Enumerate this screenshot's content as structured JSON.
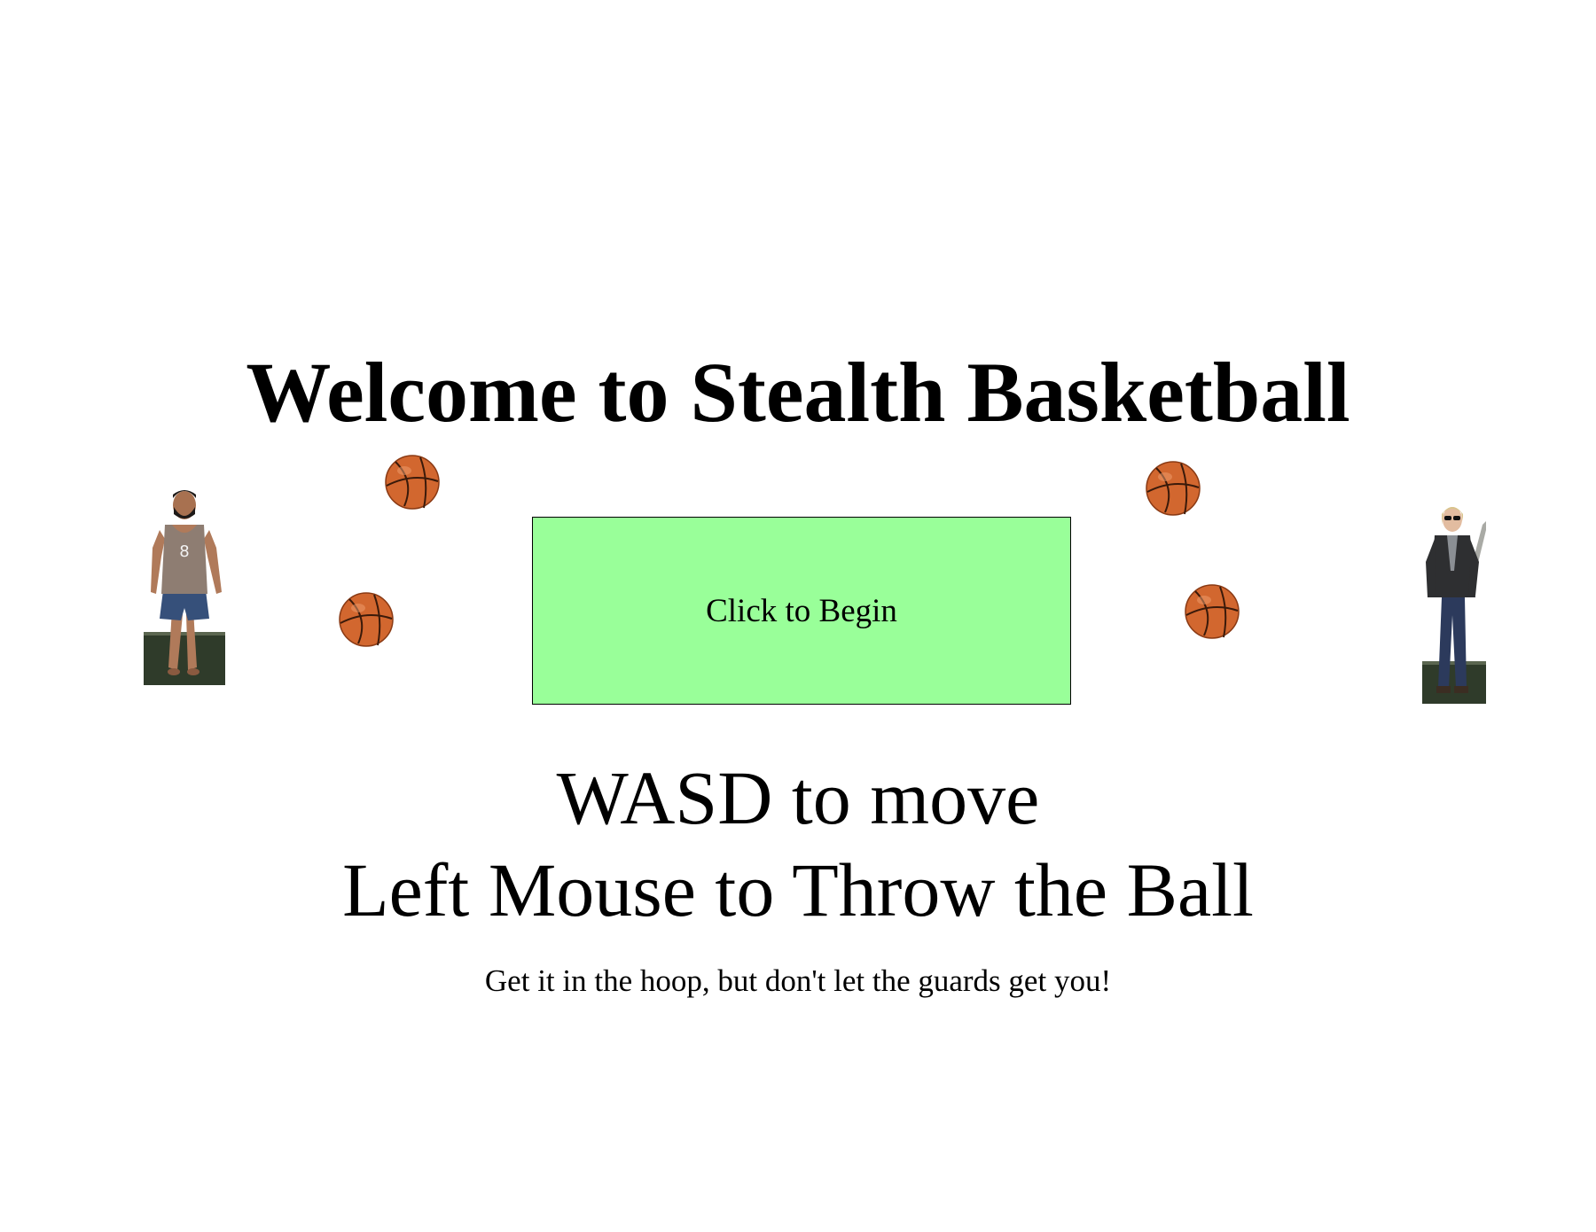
{
  "title": "Welcome to Stealth Basketball",
  "start_button_label": "Click to Begin",
  "controls": {
    "move": "WASD to move",
    "throw": "Left Mouse to Throw the Ball"
  },
  "tagline": "Get it in the hoop, but don't let the guards get you!",
  "colors": {
    "button_bg": "#99ff99",
    "ball": "#d2672f",
    "background": "#ffffff"
  },
  "sprites": {
    "player_jersey_number": "8"
  }
}
